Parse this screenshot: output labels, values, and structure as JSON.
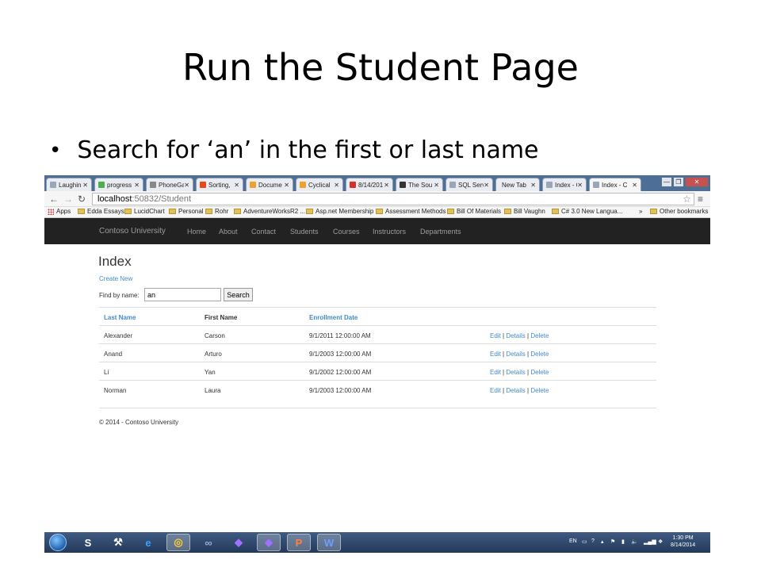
{
  "slide": {
    "title": "Run the Student Page",
    "bullet": "Search for ‘an’ in the first or last name"
  },
  "browser": {
    "tabs": [
      {
        "label": "Laughin",
        "color": "#9aa7b8"
      },
      {
        "label": "progress",
        "color": "#4caf50"
      },
      {
        "label": "PhoneGa",
        "color": "#888888"
      },
      {
        "label": "Sorting,",
        "color": "#e64a19"
      },
      {
        "label": "Docume",
        "color": "#f0a030"
      },
      {
        "label": "Cyclical",
        "color": "#f0a030"
      },
      {
        "label": "8/14/201",
        "color": "#d93025"
      },
      {
        "label": "The Sou",
        "color": "#333333"
      },
      {
        "label": "SQL Serv",
        "color": "#9aa7b8"
      },
      {
        "label": "New Tab",
        "color": "#e9edf2"
      },
      {
        "label": "Index - C",
        "color": "#9aa7b8"
      },
      {
        "label": "Index - C",
        "color": "#9aa7b8"
      }
    ],
    "url_host": "localhost",
    "url_rest": ":50832/Student",
    "bookmarks": [
      "Apps",
      "Edda Essays",
      "LucidChart",
      "Personal",
      "Rohr",
      "AdventureWorksR2 ...",
      "Asp.net Membership",
      "Assessment Methods",
      "Bill Of Materials",
      "Bill Vaughn",
      "C# 3.0 New Langua...",
      "»",
      "Other bookmarks"
    ]
  },
  "site": {
    "brand": "Contoso University",
    "nav": [
      "Home",
      "About",
      "Contact",
      "Students",
      "Courses",
      "Instructors",
      "Departments"
    ],
    "heading": "Index",
    "create_link": "Create New",
    "find_label": "Find by name:",
    "search_value": "an",
    "search_button": "Search",
    "columns": [
      "Last Name",
      "First Name",
      "Enrollment Date"
    ],
    "rows": [
      {
        "last": "Alexander",
        "first": "Carson",
        "date": "9/1/2011 12:00:00 AM"
      },
      {
        "last": "Anand",
        "first": "Arturo",
        "date": "9/1/2003 12:00:00 AM"
      },
      {
        "last": "Li",
        "first": "Yan",
        "date": "9/1/2002 12:00:00 AM"
      },
      {
        "last": "Norman",
        "first": "Laura",
        "date": "9/1/2003 12:00:00 AM"
      }
    ],
    "actions": {
      "edit": "Edit",
      "details": "Details",
      "delete": "Delete",
      "sep": "|"
    },
    "footer": "© 2014 - Contoso University"
  },
  "taskbar": {
    "apps": [
      "S",
      "⚒",
      "e",
      "◎",
      "∞",
      "◆",
      "◆",
      "P",
      "W"
    ],
    "lang": "EN",
    "time": "1:30 PM",
    "date": "8/14/2014"
  },
  "colors": {
    "link": "#428bca",
    "navbar": "#222222",
    "taskbar": "#2d4669"
  }
}
